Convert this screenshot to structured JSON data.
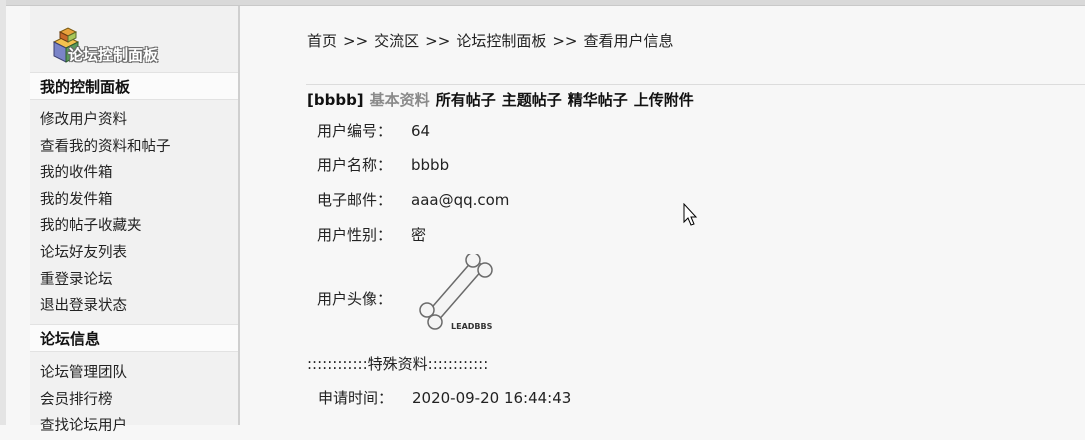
{
  "sidebar": {
    "logo_text": "论坛控制面板",
    "sections": [
      {
        "title": "我的控制面板",
        "items": [
          "修改用户资料",
          "查看我的资料和帖子",
          "我的收件箱",
          "我的发件箱",
          "我的帖子收藏夹",
          "论坛好友列表",
          "重登录论坛",
          "退出登录状态"
        ]
      },
      {
        "title": "论坛信息",
        "items": [
          "论坛管理团队",
          "会员排行榜",
          "查找论坛用户"
        ]
      }
    ]
  },
  "breadcrumb": {
    "items": [
      "首页",
      "交流区",
      "论坛控制面板",
      "查看用户信息"
    ],
    "separator": ">>"
  },
  "profile_tabs": {
    "username_tag": "[bbbb]",
    "tabs": [
      "基本资料",
      "所有帖子",
      "主题帖子",
      "精华帖子",
      "上传附件"
    ],
    "active": "基本资料"
  },
  "profile": {
    "fields": [
      {
        "label": "用户编号：",
        "value": "64"
      },
      {
        "label": "用户名称：",
        "value": "bbbb"
      },
      {
        "label": "电子邮件：",
        "value": "aaa@qq.com"
      },
      {
        "label": "用户性别：",
        "value": "密"
      },
      {
        "label": "用户头像：",
        "value": ""
      }
    ],
    "avatar_caption": "LEADBBS"
  },
  "special": {
    "heading": "::::::::::::特殊资料::::::::::::",
    "apply_time_label": "申请时间：",
    "apply_time_value": "2020-09-20 16:44:43"
  },
  "colors": {
    "active_tab": "#8a8a8a",
    "sidebar_bg": "#f1f1f1",
    "page_bg": "#f7f7f7"
  }
}
